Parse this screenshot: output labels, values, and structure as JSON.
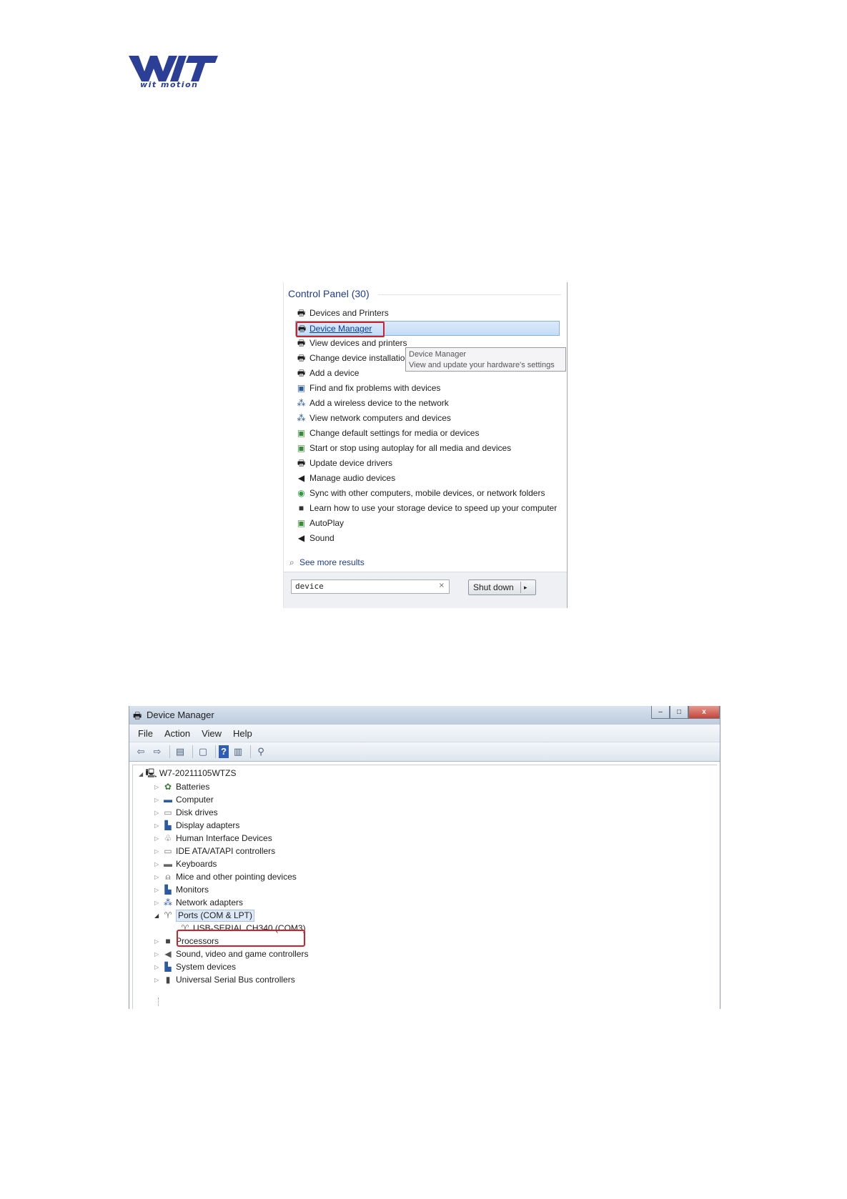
{
  "logo": {
    "brand": "WIT",
    "subtitle": "wit motion",
    "color": "#2b3f96"
  },
  "start_menu": {
    "heading": "Control Panel (30)",
    "items": [
      {
        "label": "Devices and Printers",
        "icon": "printer-icon"
      },
      {
        "label": "Device Manager",
        "icon": "printer-icon",
        "selected": true
      },
      {
        "label": "View devices and printers",
        "icon": "printer-icon"
      },
      {
        "label": "Change device installation settings",
        "icon": "printer-icon"
      },
      {
        "label": "Add a device",
        "icon": "printer-icon"
      },
      {
        "label": "Find and fix problems with devices",
        "icon": "troubleshoot-icon"
      },
      {
        "label": "Add a wireless device to the network",
        "icon": "network-icon"
      },
      {
        "label": "View network computers and devices",
        "icon": "network-icon"
      },
      {
        "label": "Change default settings for media or devices",
        "icon": "autoplay-icon"
      },
      {
        "label": "Start or stop using autoplay for all media and devices",
        "icon": "autoplay-icon"
      },
      {
        "label": "Update device drivers",
        "icon": "printer-icon"
      },
      {
        "label": "Manage audio devices",
        "icon": "speaker-icon"
      },
      {
        "label": "Sync with other computers, mobile devices, or network folders",
        "icon": "sync-icon"
      },
      {
        "label": "Learn how to use your storage device to speed up your computer",
        "icon": "storage-icon"
      },
      {
        "label": "AutoPlay",
        "icon": "autoplay-icon"
      },
      {
        "label": "Sound",
        "icon": "speaker-icon"
      }
    ],
    "tooltip": {
      "title": "Device Manager",
      "desc": "View and update your hardware's settings"
    },
    "see_more": "See more results",
    "search_value": "device",
    "search_clear": "×",
    "shutdown_label": "Shut down",
    "shutdown_arrow": "▸"
  },
  "device_manager": {
    "title": "Device Manager",
    "window_buttons": {
      "minimize": "–",
      "maximize": "□",
      "close": "x"
    },
    "menu": [
      "File",
      "Action",
      "View",
      "Help"
    ],
    "root": "W7-20211105WTZS",
    "nodes": [
      {
        "label": "Batteries",
        "icon": "battery-icon",
        "expanded": false
      },
      {
        "label": "Computer",
        "icon": "computer-icon",
        "expanded": false
      },
      {
        "label": "Disk drives",
        "icon": "disk-icon",
        "expanded": false
      },
      {
        "label": "Display adapters",
        "icon": "display-icon",
        "expanded": false
      },
      {
        "label": "Human Interface Devices",
        "icon": "hid-icon",
        "expanded": false
      },
      {
        "label": "IDE ATA/ATAPI controllers",
        "icon": "ide-icon",
        "expanded": false
      },
      {
        "label": "Keyboards",
        "icon": "keyboard-icon",
        "expanded": false
      },
      {
        "label": "Mice and other pointing devices",
        "icon": "mouse-icon",
        "expanded": false
      },
      {
        "label": "Monitors",
        "icon": "monitor-icon",
        "expanded": false
      },
      {
        "label": "Network adapters",
        "icon": "network-adapter-icon",
        "expanded": false
      },
      {
        "label": "Ports (COM & LPT)",
        "icon": "port-icon",
        "expanded": true
      },
      {
        "label": "Processors",
        "icon": "processor-icon",
        "expanded": false
      },
      {
        "label": "Sound, video and game controllers",
        "icon": "speaker-icon",
        "expanded": false
      },
      {
        "label": "System devices",
        "icon": "system-icon",
        "expanded": false
      },
      {
        "label": "Universal Serial Bus controllers",
        "icon": "usb-icon",
        "expanded": false
      }
    ],
    "ports_child": "USB-SERIAL CH340 (COM3)",
    "highlight_color": "#d0202a"
  }
}
